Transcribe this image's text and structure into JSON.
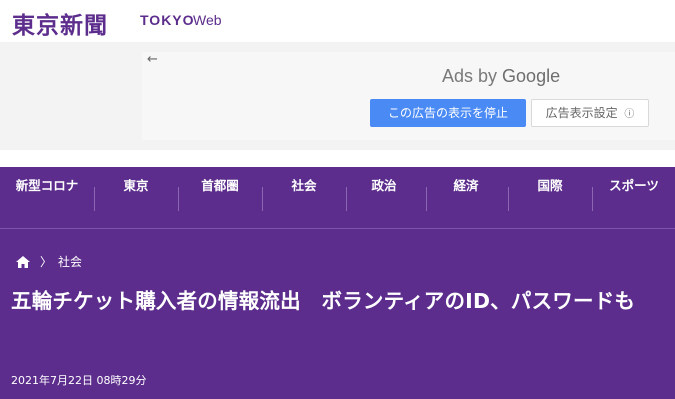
{
  "header": {
    "logo_kanji": "東京新聞",
    "logo_tokyo": "TOKYO",
    "logo_web": "Web"
  },
  "ad": {
    "back_icon": "arrow-left-icon",
    "ads_by": "Ads by",
    "google": "Google",
    "stop_button": "この広告の表示を停止",
    "settings_button": "広告表示設定",
    "info_icon": "ⓘ"
  },
  "nav": {
    "items": [
      {
        "label": "新型コロナ"
      },
      {
        "label": "東京"
      },
      {
        "label": "首都圏"
      },
      {
        "label": "社会"
      },
      {
        "label": "政治"
      },
      {
        "label": "経済"
      },
      {
        "label": "国際"
      },
      {
        "label": "スポーツ"
      }
    ]
  },
  "breadcrumb": {
    "home_icon": "home-icon",
    "separator": "〉",
    "category": "社会"
  },
  "article": {
    "title": "五輪チケット購入者の情報流出　ボランティアのID、パスワードも",
    "date": "2021年7月22日 08時29分"
  },
  "colors": {
    "brand_purple": "#5c2d8c",
    "ad_blue": "#4a8af4"
  }
}
